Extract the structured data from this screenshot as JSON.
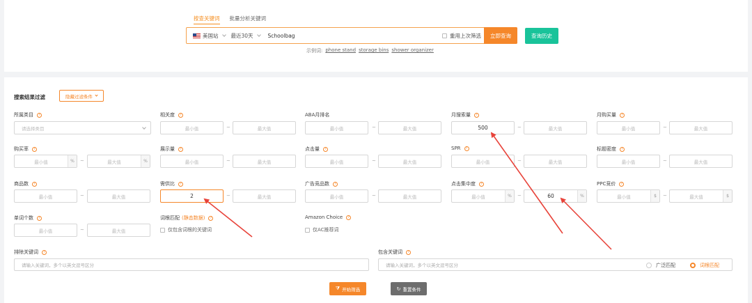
{
  "search": {
    "tabs": [
      "按查关键词",
      "批量分析关键词"
    ],
    "marketplace": "美国站",
    "period": "最近30天",
    "keyword": "Schoolbag",
    "reuse_label": "重用上次筛选",
    "query_button": "立即查询",
    "history_button": "查询历史",
    "examples_label": "示例词:",
    "examples": [
      "phone stand",
      "storage bins",
      "shower organizer"
    ]
  },
  "filters": {
    "section_title": "搜索结果过滤",
    "hide_button": "隐藏过滤条件",
    "min_placeholder": "最小值",
    "max_placeholder": "最大值",
    "unit_percent": "%",
    "unit_dollar": "$",
    "range_sep": "~",
    "category": {
      "label": "所属类目",
      "placeholder": "请选择类目"
    },
    "relevance": {
      "label": "相关度"
    },
    "aba_rank": {
      "label": "ABA月排名"
    },
    "monthly_search": {
      "label": "月搜索量",
      "min": "500"
    },
    "monthly_purchase": {
      "label": "月购买量"
    },
    "purchase_rate": {
      "label": "购买率"
    },
    "impressions": {
      "label": "展示量"
    },
    "clicks": {
      "label": "点击量"
    },
    "spr": {
      "label": "SPR"
    },
    "title_density": {
      "label": "标题密度"
    },
    "product_count": {
      "label": "商品数"
    },
    "supply_demand": {
      "label": "需供比",
      "min": "2"
    },
    "ad_products": {
      "label": "广告竞品数"
    },
    "click_concentration": {
      "label": "点击集中度",
      "max": "60"
    },
    "ppc_bid": {
      "label": "PPC竞价"
    },
    "word_count": {
      "label": "单词个数"
    },
    "root_match": {
      "label": "词根匹配",
      "tag": "(静态数据)",
      "checkbox": "仅包含词根的关键词"
    },
    "amazon_choice": {
      "label": "Amazon Choice",
      "checkbox": "仅AC推荐词"
    },
    "exclude_keywords": {
      "label": "排除关键词",
      "placeholder": "请输入关键词，多个以英文逗号区分"
    },
    "include_keywords": {
      "label": "包含关键词",
      "placeholder": "请输入关键词，多个以英文逗号区分",
      "broad_match": "广泛匹配",
      "root_match_option": "词根匹配"
    },
    "start_button": "开始筛选",
    "reset_button": "重置条件"
  },
  "colors": {
    "accent": "#f5872a",
    "teal": "#19c39a",
    "annotation": "#e8433a"
  }
}
